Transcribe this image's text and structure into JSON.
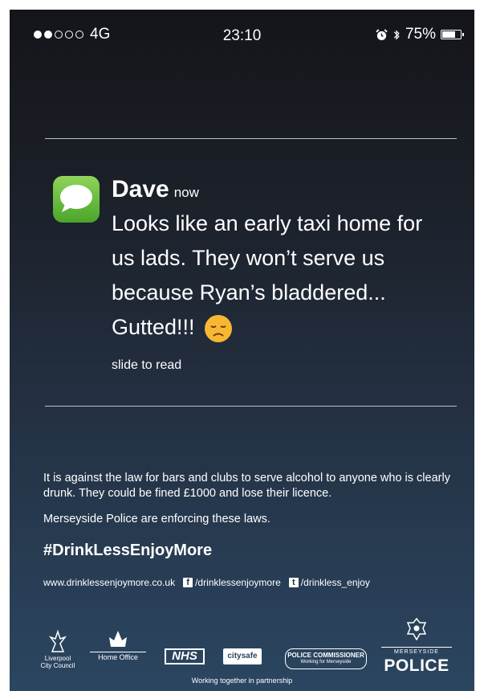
{
  "status_bar": {
    "signal_strength_filled": 2,
    "signal_strength_total": 5,
    "network": "4G",
    "time": "23:10",
    "battery_percent": "75%",
    "battery_level": 0.75,
    "icons": [
      "alarm-icon",
      "bluetooth-icon",
      "battery-icon"
    ]
  },
  "notification": {
    "app_icon": "messages-icon",
    "sender": "Dave",
    "time": "now",
    "message": "Looks like an early taxi home for us lads. They won’t serve us because Ryan’s bladdered... Gutted!!!",
    "emoji": "disappointed-face-emoji",
    "slide_hint": "slide to read"
  },
  "campaign": {
    "law_text": "It is against the law for bars and clubs to serve alcohol to anyone who is clearly drunk. They could be fined £1000 and lose their licence.",
    "enforcement_text": "Merseyside Police are enforcing these laws.",
    "hashtag": "#DrinkLessEnjoyMore",
    "website": "www.drinklessenjoymore.co.uk",
    "facebook": "/drinklessenjoymore",
    "twitter": "/drinkless_enjoy"
  },
  "partners": {
    "liverpool": "Liverpool City Council",
    "home_office": "Home Office",
    "nhs": "NHS",
    "citysafe": "citysafe",
    "commissioner": "POLICE COMMISSIONER",
    "commissioner_sub": "Working for Merseyside",
    "merseyside": "MERSEYSIDE",
    "police": "POLICE"
  },
  "footer": "Working together in partnership",
  "colors": {
    "bg_top": "#14151a",
    "bg_bottom": "#2b4661",
    "messages_green": "#5ab536",
    "emoji_yellow": "#f7b733"
  }
}
